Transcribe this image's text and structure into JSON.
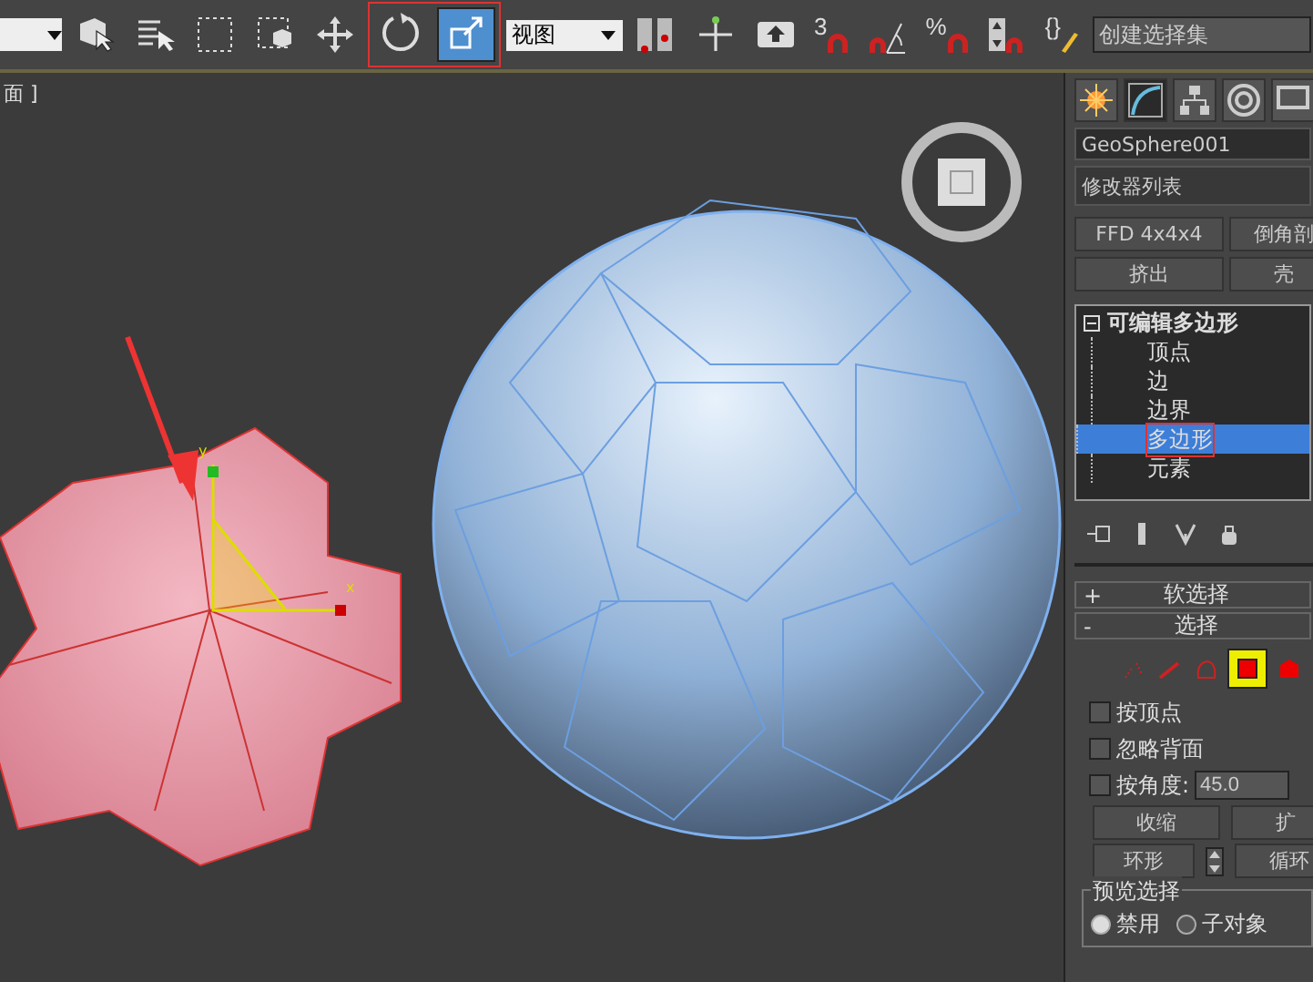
{
  "toolbar": {
    "tools": [
      {
        "kind": "select-object",
        "selected": false
      },
      {
        "kind": "select-by-name",
        "selected": false
      },
      {
        "kind": "rect-region",
        "selected": false
      },
      {
        "kind": "window-crossing",
        "selected": false
      },
      {
        "kind": "move",
        "selected": false
      },
      {
        "kind": "rotate",
        "selected": false
      },
      {
        "kind": "scale",
        "selected": true
      }
    ],
    "coord_dropdown": "视图",
    "snaps": [
      {
        "kind": "pivot"
      },
      {
        "kind": "manipulate"
      },
      {
        "kind": "keyboard"
      },
      {
        "kind": "snap3",
        "text": "3"
      },
      {
        "kind": "angle"
      },
      {
        "kind": "percent",
        "text": "%"
      },
      {
        "kind": "spinner"
      },
      {
        "kind": "edit-named",
        "text": "{}"
      }
    ],
    "selection_set": "创建选择集"
  },
  "viewport": {
    "label": "面 ]",
    "gizmo_axes": [
      "y",
      "x"
    ]
  },
  "command_panel": {
    "tabs": [
      {
        "kind": "create",
        "selected": false
      },
      {
        "kind": "modify",
        "selected": true
      },
      {
        "kind": "hierarchy",
        "selected": false
      },
      {
        "kind": "motion",
        "selected": false
      },
      {
        "kind": "display",
        "selected": false
      }
    ],
    "object_name": "GeoSphere001",
    "modifier_list": "修改器列表",
    "modifier_buttons": [
      "FFD 4x4x4",
      "倒角剖",
      "挤出",
      "壳"
    ],
    "stack": {
      "label": "可编辑多边形",
      "expanded": true,
      "children": [
        {
          "label": "顶点",
          "selected": false
        },
        {
          "label": "边",
          "selected": false
        },
        {
          "label": "边界",
          "selected": false
        },
        {
          "label": "多边形",
          "selected": true
        },
        {
          "label": "元素",
          "selected": false
        }
      ]
    },
    "rollouts": [
      {
        "sign": "+",
        "title": "软选择"
      },
      {
        "sign": "-",
        "title": "选择"
      }
    ],
    "levels": [
      {
        "kind": "vertex",
        "selected": false
      },
      {
        "kind": "edge",
        "selected": false
      },
      {
        "kind": "border",
        "selected": false
      },
      {
        "kind": "polygon",
        "selected": true
      },
      {
        "kind": "element",
        "selected": false
      }
    ],
    "checks": [
      {
        "label": "按顶点",
        "checked": false
      },
      {
        "label": "忽略背面",
        "checked": false
      },
      {
        "label": "按角度:",
        "checked": false,
        "value": "45.0"
      }
    ],
    "grow_buttons": [
      "收缩",
      "扩"
    ],
    "loop_buttons": [
      "环形",
      "循环"
    ],
    "preview": {
      "title": "预览选择",
      "options": [
        {
          "label": "禁用",
          "selected": true
        },
        {
          "label": "子对象",
          "selected": false
        }
      ]
    }
  }
}
